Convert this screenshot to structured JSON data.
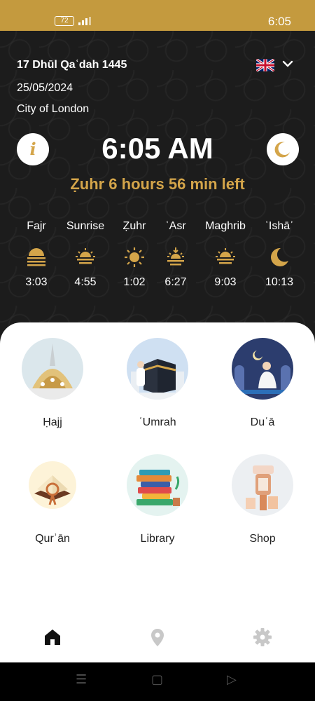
{
  "status_bar": {
    "battery": "72",
    "time": "6:05"
  },
  "header": {
    "hijri_date": "17 Dhūl Qaʿdah 1445",
    "gregorian_date": "25/05/2024",
    "city": "City of London",
    "language_flag": "uk-flag-icon"
  },
  "clock": {
    "time": "6:05 AM",
    "next_prayer": "Ẓuhr 6 hours 56 min left"
  },
  "prayers": [
    {
      "name": "Fajr",
      "time": "3:03",
      "icon": "fajr-icon"
    },
    {
      "name": "Sunrise",
      "time": "4:55",
      "icon": "sunrise-icon"
    },
    {
      "name": "Ẓuhr",
      "time": "1:02",
      "icon": "sun-icon"
    },
    {
      "name": "ʿAsr",
      "time": "6:27",
      "icon": "asr-icon"
    },
    {
      "name": "Maghrib",
      "time": "9:03",
      "icon": "sunset-icon"
    },
    {
      "name": "ʿIshāʾ",
      "time": "10:13",
      "icon": "crescent-moon-icon"
    }
  ],
  "tiles": [
    {
      "label": "Ḥajj",
      "icon": "hajj-image"
    },
    {
      "label": "ʿUmrah",
      "icon": "umrah-image"
    },
    {
      "label": "Duʿā",
      "icon": "dua-image"
    },
    {
      "label": "Qurʾān",
      "icon": "quran-image"
    },
    {
      "label": "Library",
      "icon": "library-image"
    },
    {
      "label": "Shop",
      "icon": "shop-image"
    }
  ],
  "bottom_nav": [
    {
      "icon": "home-icon",
      "active": true
    },
    {
      "icon": "location-pin-icon",
      "active": false
    },
    {
      "icon": "gear-icon",
      "active": false
    }
  ],
  "colors": {
    "accent": "#d4a54a",
    "status_bar": "#c49a3e",
    "background": "#1c1c1c"
  }
}
